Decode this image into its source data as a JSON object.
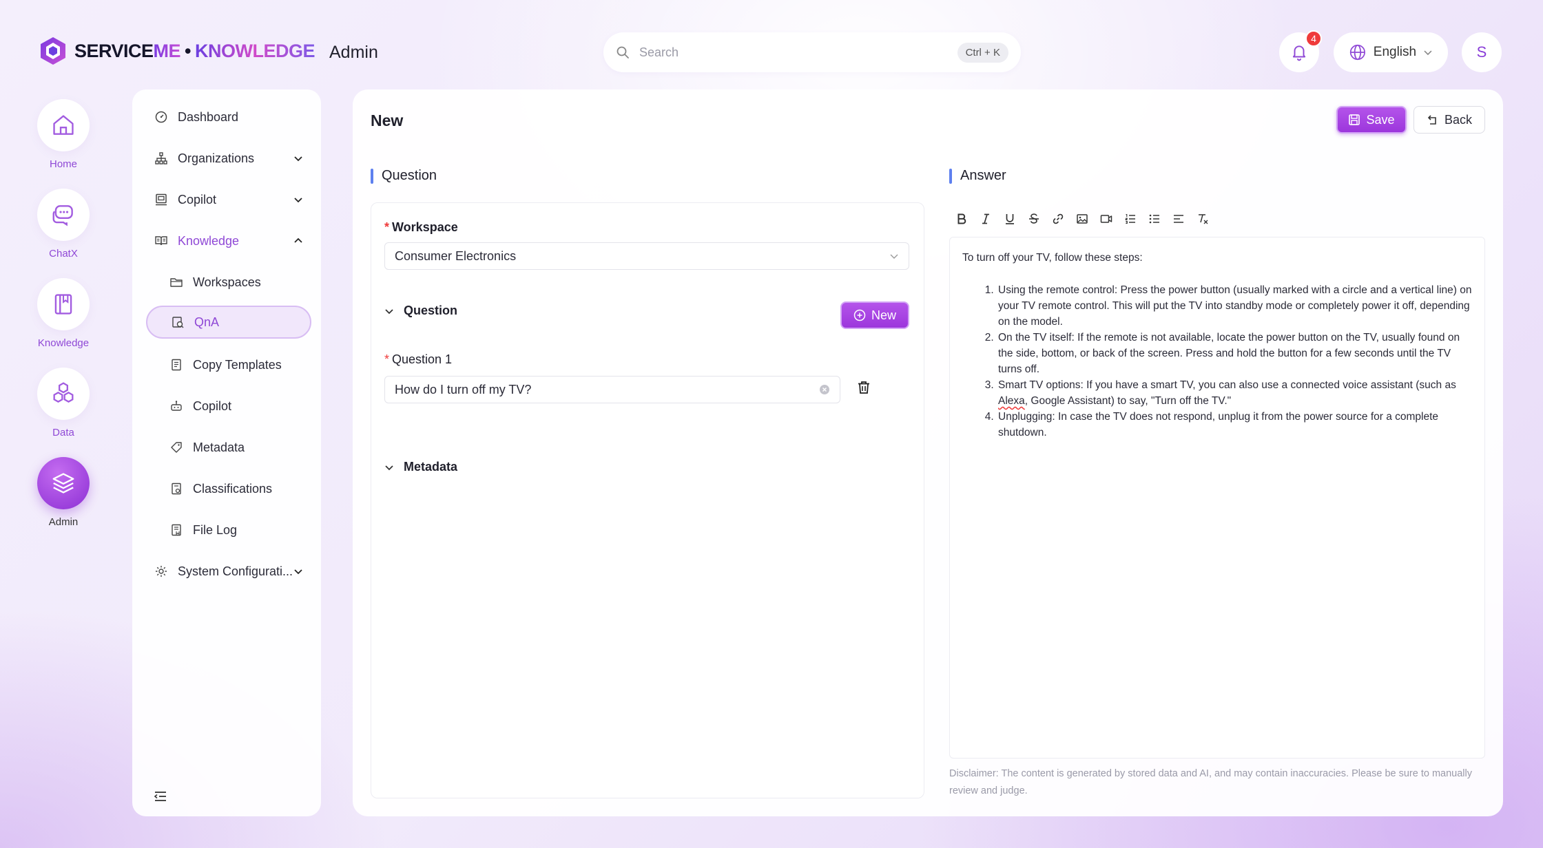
{
  "header": {
    "logo": {
      "part1": "SERVICE",
      "part2": "ME",
      "separator": "•",
      "part3": "KNOWLEDGE"
    },
    "title": "Admin",
    "search": {
      "placeholder": "Search",
      "shortcut": "Ctrl + K"
    },
    "notifications": {
      "count": "4"
    },
    "language": "English",
    "user_initial": "S"
  },
  "rail": [
    {
      "label": "Home",
      "icon": "home-icon"
    },
    {
      "label": "ChatX",
      "icon": "chat-icon"
    },
    {
      "label": "Knowledge",
      "icon": "book-icon"
    },
    {
      "label": "Data",
      "icon": "hexagons-icon"
    },
    {
      "label": "Admin",
      "icon": "layers-icon"
    }
  ],
  "sidenav": {
    "items": [
      {
        "label": "Dashboard"
      },
      {
        "label": "Organizations"
      },
      {
        "label": "Copilot"
      },
      {
        "label": "Knowledge"
      },
      {
        "label": "Workspaces"
      },
      {
        "label": "QnA"
      },
      {
        "label": "Copy Templates"
      },
      {
        "label": "Copilot"
      },
      {
        "label": "Metadata"
      },
      {
        "label": "Classifications"
      },
      {
        "label": "File Log"
      },
      {
        "label": "System Configurati..."
      }
    ]
  },
  "page": {
    "title": "New",
    "save_label": "Save",
    "back_label": "Back"
  },
  "question_section": {
    "heading": "Question",
    "workspace_label": "Workspace",
    "workspace_value": "Consumer Electronics",
    "question_group_label": "Question",
    "new_label": "New",
    "question1_label": "Question 1",
    "question1_value": "How do I turn off my TV?",
    "metadata_label": "Metadata"
  },
  "answer_section": {
    "heading": "Answer",
    "intro": "To turn off your TV, follow these steps:",
    "steps": [
      "Using the remote control: Press the power button (usually marked with a circle and a vertical line) on your TV remote control. This will put the TV into standby mode or completely power it off, depending on the model.",
      "On the TV itself: If the remote is not available, locate the power button on the TV, usually found on the side, bottom, or back of the screen. Press and hold the button for a few seconds until the TV turns off.",
      "Unplugging: In case the TV does not respond, unplug it from the power source for a complete shutdown."
    ],
    "step3": {
      "before": "Smart TV options: If you have a smart TV, you can also use a connected voice assistant (such as ",
      "misspelled": "Alexa",
      "after": ", Google Assistant) to say, \"Turn off the TV.\""
    },
    "disclaimer": "Disclaimer: The content is generated by stored data and AI, and may contain inaccuracies. Please be sure to manually review and judge."
  },
  "colors": {
    "accent": "#9c36dc",
    "section_bar": "#5e80ef",
    "required": "#ef3b3b"
  }
}
